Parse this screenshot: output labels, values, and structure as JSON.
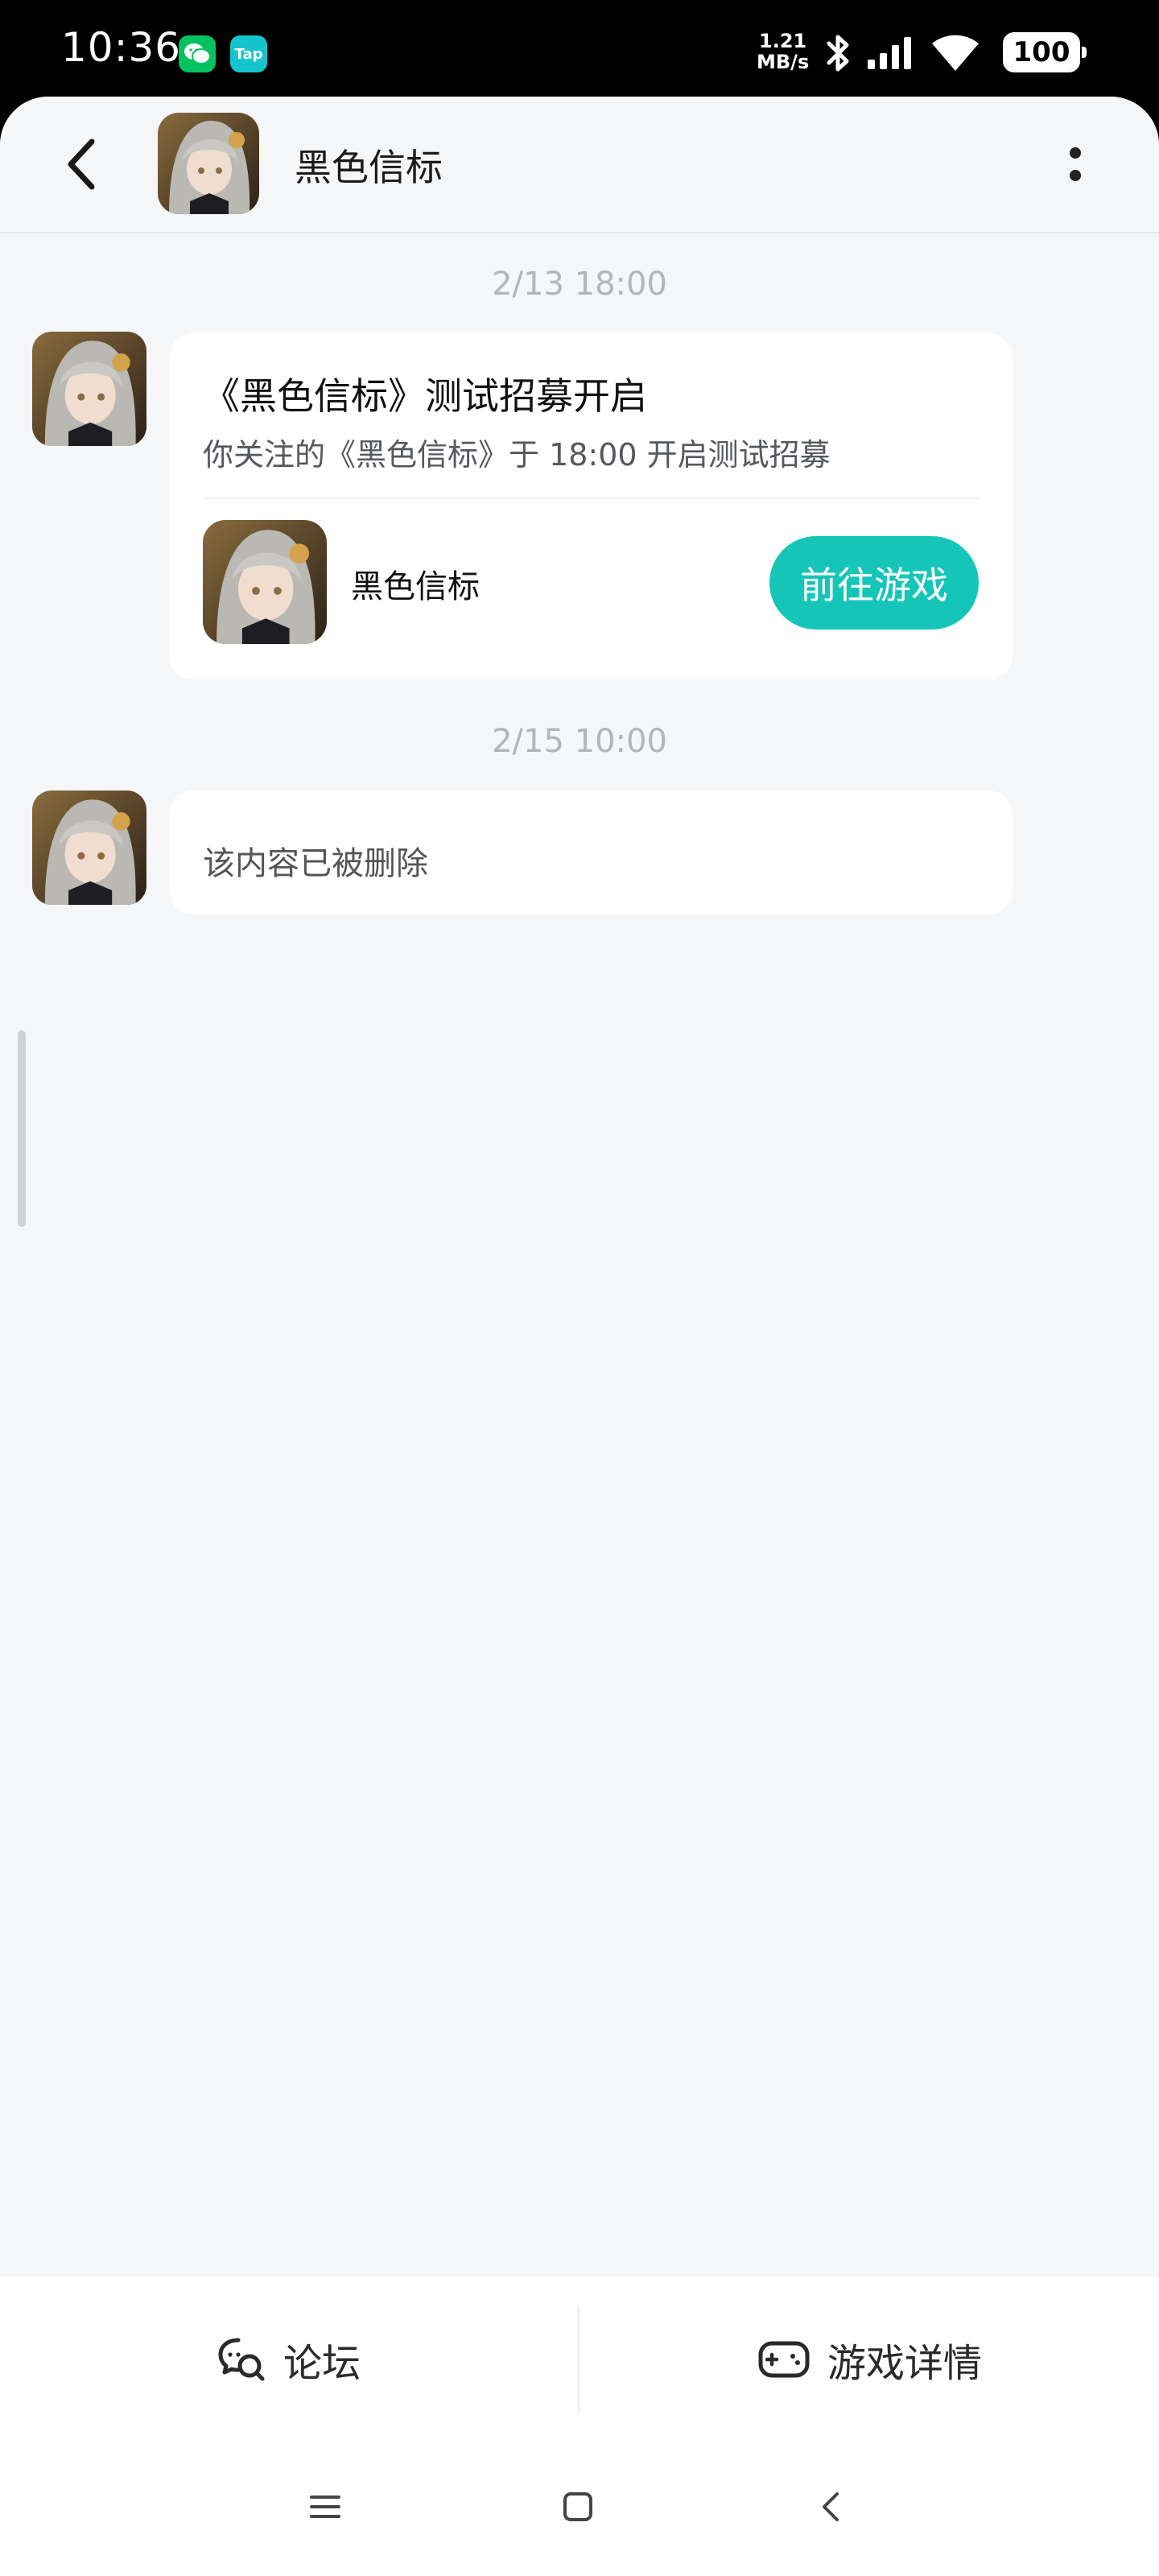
{
  "status_bar": {
    "time": "10:36",
    "app_icons": [
      {
        "name": "wechat-icon",
        "label": ""
      },
      {
        "name": "taptap-icon",
        "label": "Tap"
      }
    ],
    "net_speed_value": "1.21",
    "net_speed_unit": "MB/s",
    "battery": "100"
  },
  "header": {
    "title": "黑色信标",
    "back_icon": "chevron-left-icon",
    "more_icon": "more-vertical-icon"
  },
  "messages": [
    {
      "timestamp": "2/13  18:00",
      "type": "card",
      "title": "《黑色信标》测试招募开启",
      "subtitle": "你关注的《黑色信标》于 18:00 开启测试招募",
      "game_name": "黑色信标",
      "button_label": "前往游戏"
    },
    {
      "timestamp": "2/15  10:00",
      "type": "text",
      "text": "该内容已被删除"
    }
  ],
  "bottom_tabs": [
    {
      "label": "论坛",
      "icon": "forum-chat-icon"
    },
    {
      "label": "游戏详情",
      "icon": "gamepad-icon"
    }
  ],
  "nav_bar": [
    "menu-icon",
    "home-icon",
    "back-icon"
  ],
  "colors": {
    "accent": "#15c5b8",
    "background": "#f5f6f8",
    "timestamp": "#b3b5b9"
  }
}
